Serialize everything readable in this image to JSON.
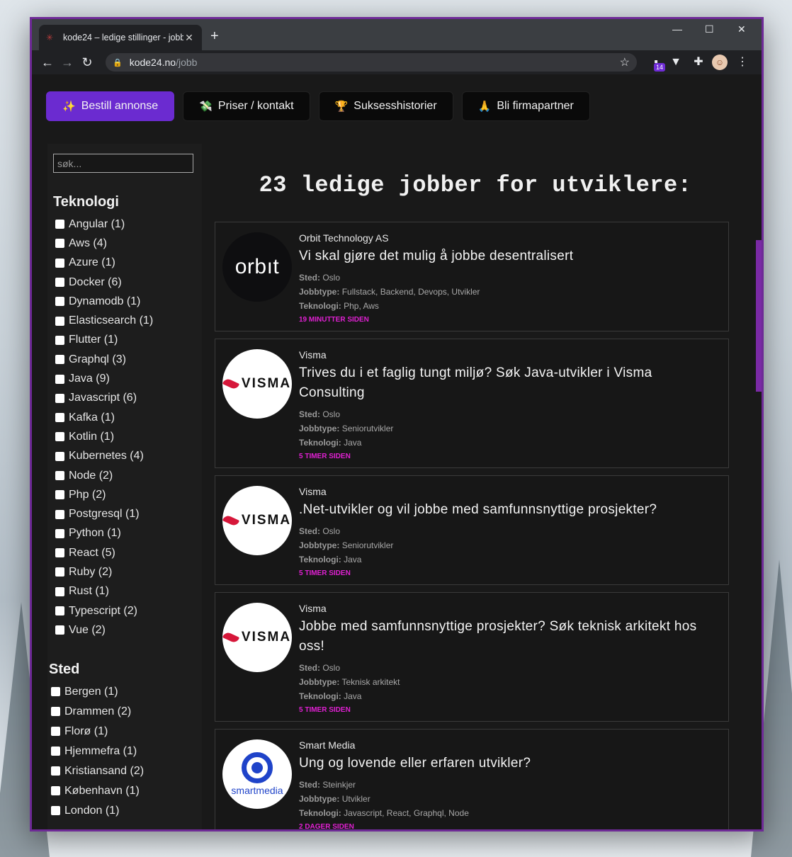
{
  "browser": {
    "tab_title": "kode24 – ledige stillinger - jobb",
    "url_host": "kode24.no",
    "url_path": "/jobb",
    "extension_badge": "14"
  },
  "nav": [
    {
      "emoji": "✨",
      "label": "Bestill annonse"
    },
    {
      "emoji": "💸",
      "label": "Priser / kontakt"
    },
    {
      "emoji": "🏆",
      "label": "Suksesshistorier"
    },
    {
      "emoji": "🙏",
      "label": "Bli firmapartner"
    }
  ],
  "sidebar": {
    "search_placeholder": "søk...",
    "tech_heading": "Teknologi",
    "tech": [
      "Angular (1)",
      "Aws (4)",
      "Azure (1)",
      "Docker (6)",
      "Dynamodb (1)",
      "Elasticsearch (1)",
      "Flutter (1)",
      "Graphql (3)",
      "Java (9)",
      "Javascript (6)",
      "Kafka (1)",
      "Kotlin (1)",
      "Kubernetes (4)",
      "Node (2)",
      "Php (2)",
      "Postgresql (1)",
      "Python (1)",
      "React (5)",
      "Ruby (2)",
      "Rust (1)",
      "Typescript (2)",
      "Vue (2)"
    ],
    "sted_heading": "Sted",
    "sted": [
      "Bergen (1)",
      "Drammen (2)",
      "Florø (1)",
      "Hjemmefra (1)",
      "Kristiansand (2)",
      "København (1)",
      "London (1)"
    ]
  },
  "main": {
    "title": "23 ledige jobber for utviklere:",
    "labels": {
      "sted": "Sted:",
      "jobbtype": "Jobbtype:",
      "teknologi": "Teknologi:"
    },
    "jobs": [
      {
        "logo": "orbit",
        "logo_text": "orbıt",
        "company": "Orbit Technology AS",
        "title": "Vi skal gjøre det mulig å jobbe desentralisert",
        "sted": "Oslo",
        "jobbtype": "Fullstack, Backend, Devops, Utvikler",
        "teknologi": "Php, Aws",
        "age": "19 minutter siden"
      },
      {
        "logo": "visma",
        "logo_text": "VISMA",
        "company": "Visma",
        "title": "Trives du i et faglig tungt miljø? Søk Java-utvikler i Visma Consulting",
        "sted": "Oslo",
        "jobbtype": "Seniorutvikler",
        "teknologi": "Java",
        "age": "5 timer siden"
      },
      {
        "logo": "visma",
        "logo_text": "VISMA",
        "company": "Visma",
        "title": ".Net-utvikler og vil jobbe med samfunnsnyttige prosjekter?",
        "sted": "Oslo",
        "jobbtype": "Seniorutvikler",
        "teknologi": "Java",
        "age": "5 timer siden"
      },
      {
        "logo": "visma",
        "logo_text": "VISMA",
        "company": "Visma",
        "title": "Jobbe med samfunnsnyttige prosjekter? Søk teknisk arkitekt hos oss!",
        "sted": "Oslo",
        "jobbtype": "Teknisk arkitekt",
        "teknologi": "Java",
        "age": "5 timer siden"
      },
      {
        "logo": "smartmedia",
        "logo_text": "smartmedia",
        "company": "Smart Media",
        "title": "Ung og lovende eller erfaren utvikler?",
        "sted": "Steinkjer",
        "jobbtype": "Utvikler",
        "teknologi": "Javascript, React, Graphql, Node",
        "age": "2 dager siden"
      }
    ]
  },
  "colors": {
    "accent": "#6b2bd0",
    "age": "#e020d2",
    "window_border": "#6e2a96"
  }
}
